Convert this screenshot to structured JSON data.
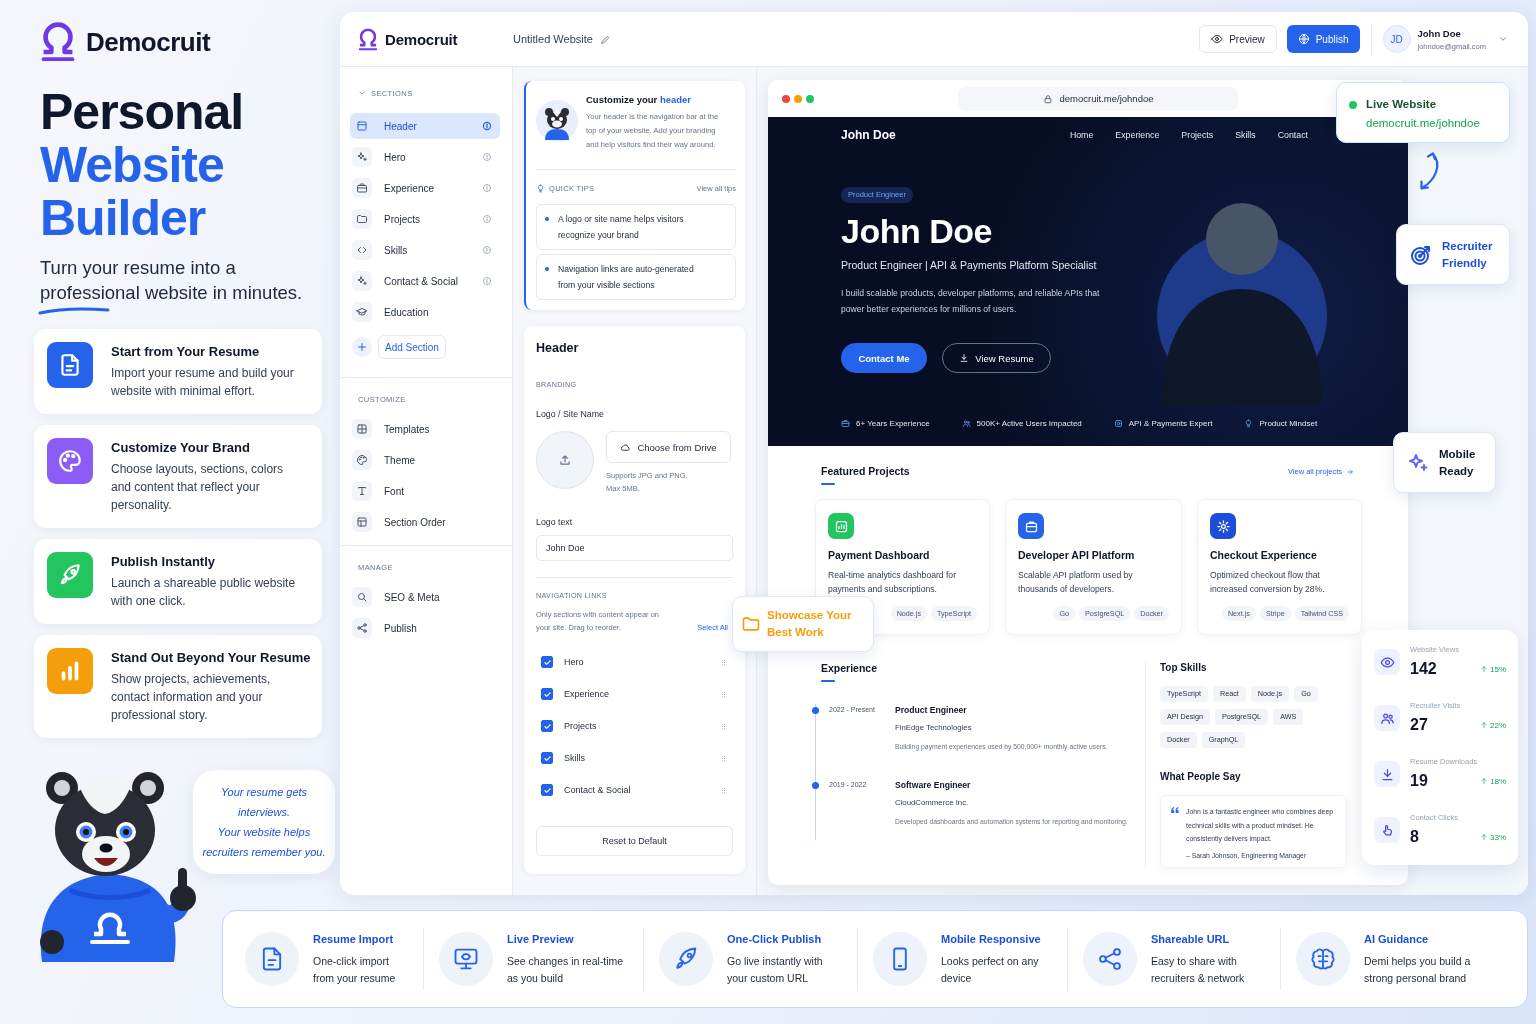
{
  "brand": {
    "name": "Democruit"
  },
  "headline": {
    "lines": [
      {
        "text": "Personal",
        "accent": false
      },
      {
        "text": "Website",
        "accent": true
      },
      {
        "text": "Builder",
        "accent": true
      }
    ],
    "subtitle": "Turn your resume into a professional website in minutes."
  },
  "features": [
    {
      "kind": "document",
      "color": "#2563eb",
      "title": "Start from Your Resume",
      "text": "Import your resume and build your website with minimal effort."
    },
    {
      "kind": "palette",
      "color": "#8b5cf6",
      "title": "Customize Your Brand",
      "text": "Choose layouts, sections, colors and content that reflect your personality."
    },
    {
      "kind": "rocket",
      "color": "#22c55e",
      "title": "Publish Instantly",
      "text": "Launch a shareable public website with one click."
    },
    {
      "kind": "chart",
      "color": "#f59e0b",
      "title": "Stand Out Beyond Your Resume",
      "text": "Show projects, achievements, contact information and your professional story."
    }
  ],
  "mascot": {
    "speech_lines": [
      "Your resume gets",
      "interviews.",
      "Your website helps",
      "recruiters remember you."
    ]
  },
  "topbar": {
    "brand": "Democruit",
    "document_title": "Untitled Website",
    "buttons": [
      {
        "kind": "preview",
        "label": "Preview"
      },
      {
        "kind": "publish",
        "label": "Publish"
      }
    ],
    "user": {
      "initials": "JD",
      "name": "John Doe",
      "email": "johndoe@gmail.com"
    }
  },
  "sidebar": {
    "groups": [
      {
        "title": "SECTIONS",
        "expanded": true,
        "items": [
          {
            "kind": "header",
            "label": "Header",
            "selected": true,
            "toggle": true
          },
          {
            "kind": "sparkle",
            "label": "Hero",
            "selected": false,
            "toggle": true
          },
          {
            "kind": "briefcase",
            "label": "Experience",
            "selected": false,
            "toggle": true
          },
          {
            "kind": "folder",
            "label": "Projects",
            "selected": false,
            "toggle": true
          },
          {
            "kind": "code",
            "label": "Skills",
            "selected": false,
            "toggle": true
          },
          {
            "kind": "sparkle",
            "label": "Contact & Social",
            "selected": false,
            "toggle": true
          },
          {
            "kind": "cap",
            "label": "Education",
            "selected": false,
            "toggle": false
          }
        ],
        "add_button": "Add Section"
      },
      {
        "title": "CUSTOMIZE",
        "items": [
          {
            "kind": "grid",
            "label": "Templates",
            "selected": false,
            "toggle": false
          },
          {
            "kind": "palette",
            "label": "Theme",
            "selected": false,
            "toggle": false
          },
          {
            "kind": "type",
            "label": "Font",
            "selected": false,
            "toggle": false
          },
          {
            "kind": "layout",
            "label": "Section Order",
            "selected": false,
            "toggle": false
          }
        ]
      },
      {
        "title": "MANAGE",
        "items": [
          {
            "kind": "search",
            "label": "SEO & Meta",
            "selected": false,
            "toggle": false
          },
          {
            "kind": "share",
            "label": "Publish",
            "selected": false,
            "toggle": false
          }
        ]
      }
    ]
  },
  "panel": {
    "tip": {
      "title": "Customize your",
      "title_accent": "header",
      "text": "Your header is the navigation bar at the top of your website. Add your branding and help visitors find their way around.",
      "tips_label": "QUICK TIPS",
      "tips_link": "View all tips",
      "tips": [
        "A logo or site name helps visitors recognize your brand",
        "Navigation links are auto-generated from your visible sections"
      ]
    },
    "form": {
      "title": "Header",
      "branding_label": "BRANDING",
      "logo_label": "Logo / Site Name",
      "drive_button": "Choose from Drive",
      "upload_hint_lines": [
        "Supports JPG and PNG.",
        "Max 5MB."
      ],
      "logo_text_label": "Logo text",
      "logo_text_value": "John Doe",
      "nav_label": "NAVIGATION LINKS",
      "nav_hint": "Only sections with content appear on your site. Drag to reorder.",
      "select_all": "Select All",
      "nav_links": [
        {
          "label": "Hero",
          "checked": true
        },
        {
          "label": "Experience",
          "checked": true
        },
        {
          "label": "Projects",
          "checked": true
        },
        {
          "label": "Skills",
          "checked": true
        },
        {
          "label": "Contact & Social",
          "checked": true
        }
      ],
      "reset_button": "Reset to Default"
    }
  },
  "preview": {
    "url": "democruit.me/johndoe",
    "site": {
      "nav_brand": "John Doe",
      "nav_links": [
        "Home",
        "Experience",
        "Projects",
        "Skills",
        "Contact"
      ],
      "badge": "Product Engineer",
      "name": "John Doe",
      "tagline": "Product Engineer | API & Payments Platform Specialist",
      "bio": "I build scalable products, developer platforms, and reliable APIs that power better experiences for millions of users.",
      "buttons": [
        {
          "kind": "contact",
          "label": "Contact Me"
        },
        {
          "kind": "resume",
          "label": "View Resume"
        }
      ],
      "highlights": [
        {
          "kind": "briefcase",
          "text": "6+ Years Experience"
        },
        {
          "kind": "users",
          "text": "500K+ Active Users Impacted"
        },
        {
          "kind": "api",
          "text": "API & Payments Expert"
        },
        {
          "kind": "bulb",
          "text": "Product Mindset"
        }
      ],
      "projects_title": "Featured Projects",
      "projects_link": "View all projects",
      "projects": [
        {
          "kind": "dashboard",
          "color": "#22c55e",
          "title": "Payment Dashboard",
          "text": "Real-time analytics dashboard for payments and subscriptions.",
          "tags": [
            "Node.js",
            "TypeScript"
          ]
        },
        {
          "kind": "bag",
          "color": "#2563eb",
          "title": "Developer API Platform",
          "text": "Scalable API platform used by thousands of developers.",
          "tags": [
            "Go",
            "PostgreSQL",
            "Docker"
          ]
        },
        {
          "kind": "gear",
          "color": "#1d4ed8",
          "title": "Checkout Experience",
          "text": "Optimized checkout flow that increased conversion by 28%.",
          "tags": [
            "Next.js",
            "Stripe",
            "Tailwind CSS"
          ]
        }
      ],
      "experience_title": "Experience",
      "experience": [
        {
          "period": "2022 - Present",
          "role": "Product Engineer",
          "company": "FinEdge Technologies",
          "text": "Building payment experiences used by 500,000+ monthly active users."
        },
        {
          "period": "2019 - 2022",
          "role": "Software Engineer",
          "company": "CloudCommerce Inc.",
          "text": "Developed dashboards and automation systems for reporting and monitoring."
        }
      ],
      "skills_title": "Top Skills",
      "skills": [
        "TypeScript",
        "React",
        "Node.js",
        "Go",
        "API Design",
        "PostgreSQL",
        "AWS",
        "Docker",
        "GraphQL"
      ],
      "testimonial_title": "What People Say",
      "testimonial": {
        "quote": "John is a fantastic engineer who combines deep technical skills with a product mindset. He consistently delivers impact.",
        "author": "– Sarah Johnson, Engineering Manager"
      }
    }
  },
  "live_badge": {
    "title": "Live Website",
    "url": "democruit.me/johndoe"
  },
  "callouts": [
    {
      "kind": "target",
      "color": "#1d4ed8",
      "tinted": true,
      "lines": [
        "Recruiter",
        "Friendly"
      ]
    },
    {
      "kind": "sparkle",
      "color": "#6366f1",
      "tinted": false,
      "lines": [
        "Mobile",
        "Ready"
      ]
    },
    {
      "kind": "folder",
      "color": "#f59e0b",
      "tinted": true,
      "lines": [
        "Showcase Your",
        "Best Work"
      ]
    }
  ],
  "stats": [
    {
      "kind": "eye",
      "label": "Website Views",
      "value": "142",
      "change": "15%"
    },
    {
      "kind": "users",
      "label": "Recruiter Visits",
      "value": "27",
      "change": "22%"
    },
    {
      "kind": "download",
      "label": "Resume Downloads",
      "value": "19",
      "change": "18%"
    },
    {
      "kind": "pointer",
      "label": "Contact Clicks",
      "value": "8",
      "change": "33%"
    }
  ],
  "benefits": [
    {
      "kind": "document",
      "title": "Resume Import",
      "lines": [
        "One-click import",
        "from your resume"
      ]
    },
    {
      "kind": "monitor",
      "title": "Live Preview",
      "lines": [
        "See changes in real-time",
        "as you build"
      ]
    },
    {
      "kind": "rocket",
      "title": "One-Click Publish",
      "lines": [
        "Go live instantly with",
        "your custom URL"
      ]
    },
    {
      "kind": "phone",
      "title": "Mobile Responsive",
      "lines": [
        "Looks perfect on any",
        "device"
      ]
    },
    {
      "kind": "share",
      "title": "Shareable URL",
      "lines": [
        "Easy to share with",
        "recruiters & network"
      ]
    },
    {
      "kind": "brain",
      "title": "AI Guidance",
      "lines": [
        "Demi helps you build a",
        "strong personal brand"
      ]
    }
  ]
}
